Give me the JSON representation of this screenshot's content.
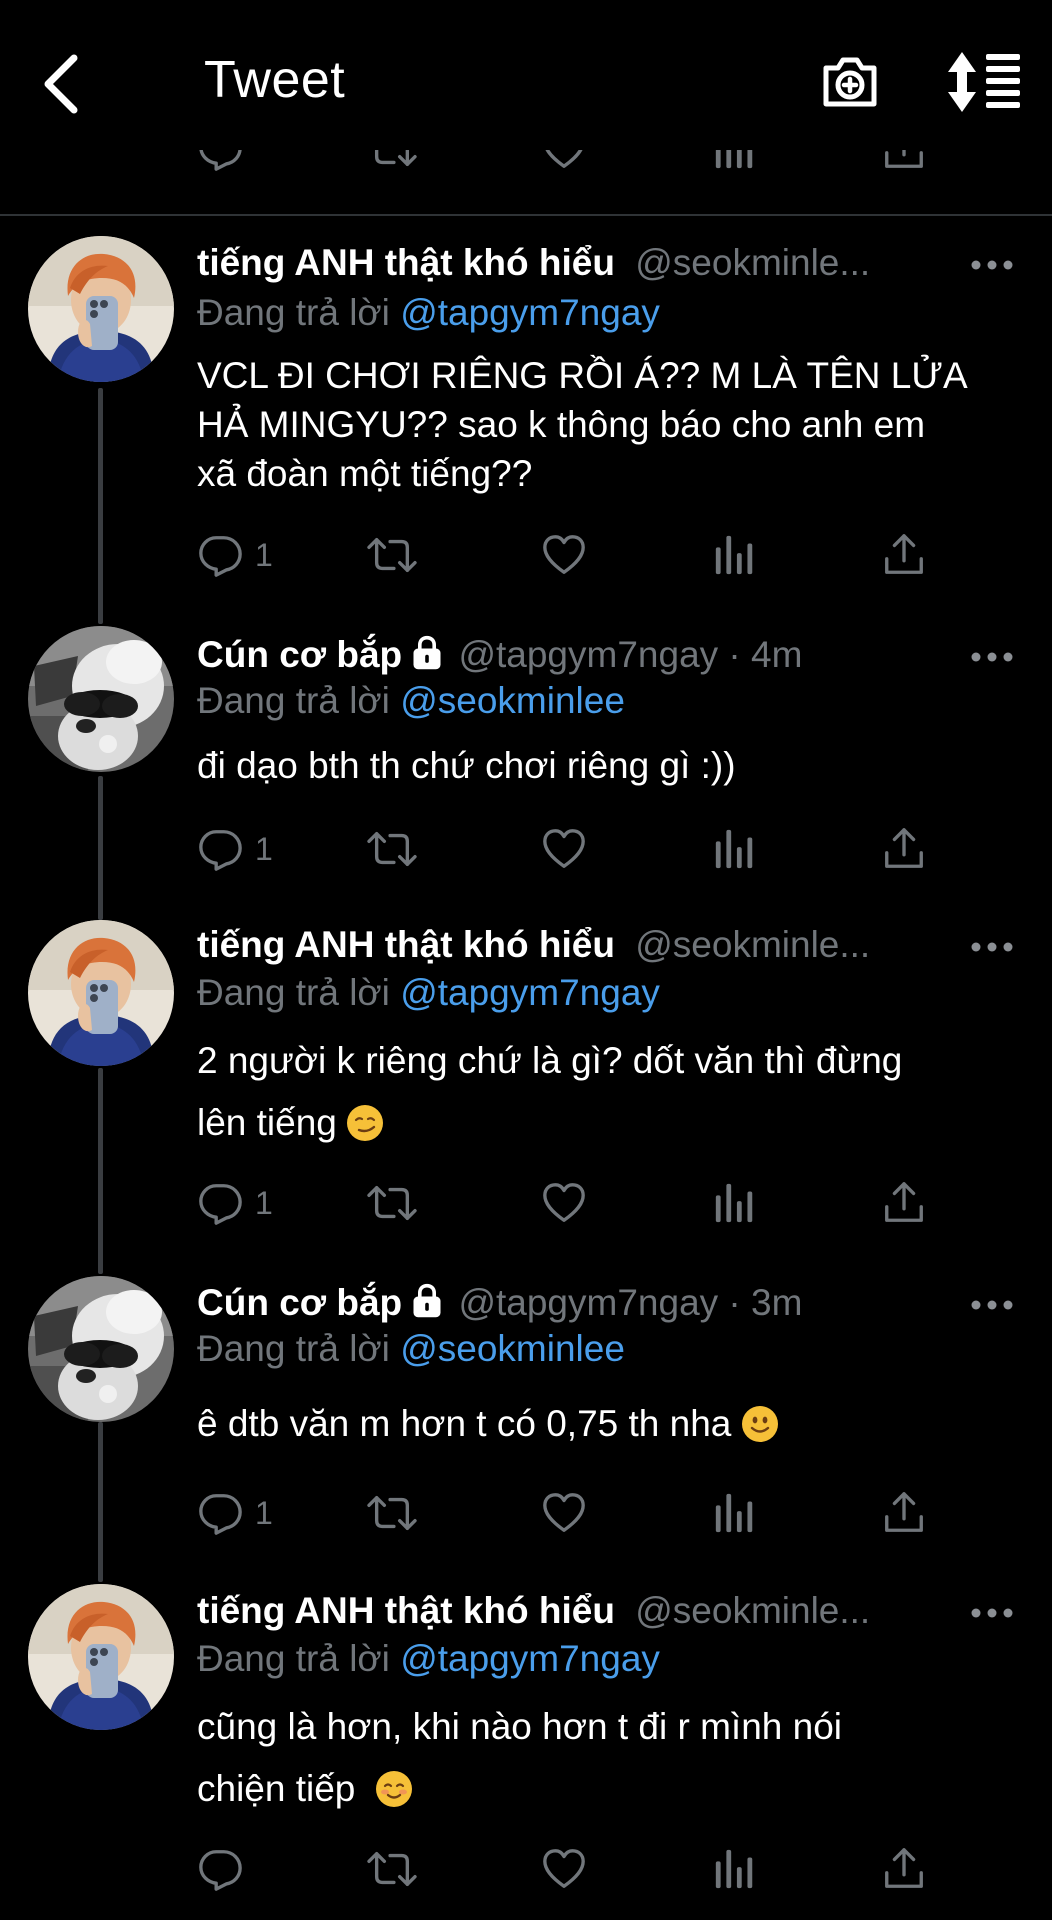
{
  "header": {
    "title": "Tweet"
  },
  "tweets": [
    {
      "name": "tiếng ANH thật khó hiểu",
      "handle": "@seokminle...",
      "time": "",
      "locked": false,
      "reply_prefix": "Đang trả lời ",
      "reply_to": "@tapgym7ngay",
      "text_lines": [
        "VCL ĐI CHƠI RIÊNG RỒI Á?? M LÀ TÊN LỬA",
        "HẢ MINGYU?? sao k thông báo cho anh em",
        "xã đoàn một tiếng??"
      ],
      "reply_count": "1",
      "avatar": "orange-hair-selfie-avatar"
    },
    {
      "name": "Cún cơ bắp",
      "handle": "@tapgym7ngay · 4m",
      "locked": true,
      "reply_prefix": "Đang trả lời ",
      "reply_to": "@seokminlee",
      "text_lines": [
        "đi dạo bth th chứ chơi riêng gì :))"
      ],
      "reply_count": "1",
      "avatar": "white-dog-sunglasses-avatar"
    },
    {
      "name": "tiếng ANH thật khó hiểu",
      "handle": "@seokminle...",
      "locked": false,
      "reply_prefix": "Đang trả lời ",
      "reply_to": "@tapgym7ngay",
      "text_lines": [
        "2 người k riêng chứ là gì? dốt văn thì đừng",
        "lên tiếng"
      ],
      "emoji": "smirk-emoji",
      "reply_count": "1",
      "avatar": "orange-hair-selfie-avatar"
    },
    {
      "name": "Cún cơ bắp",
      "handle": "@tapgym7ngay · 3m",
      "locked": true,
      "reply_prefix": "Đang trả lời ",
      "reply_to": "@seokminlee",
      "text_lines": [
        "ê dtb văn m hơn t có 0,75 th nha"
      ],
      "emoji": "slight-smile-emoji",
      "reply_count": "1",
      "avatar": "white-dog-sunglasses-avatar"
    },
    {
      "name": "tiếng ANH thật khó hiểu",
      "handle": "@seokminle...",
      "locked": false,
      "reply_prefix": "Đang trả lời ",
      "reply_to": "@tapgym7ngay",
      "text_lines": [
        "cũng là hơn, khi nào hơn t đi r mình nói",
        "chiện tiếp"
      ],
      "emoji": "blush-emoji",
      "reply_count": "",
      "avatar": "orange-hair-selfie-avatar"
    }
  ],
  "colors": {
    "background": "#000000",
    "mention": "#4a9eeb",
    "muted": "#71767b"
  }
}
